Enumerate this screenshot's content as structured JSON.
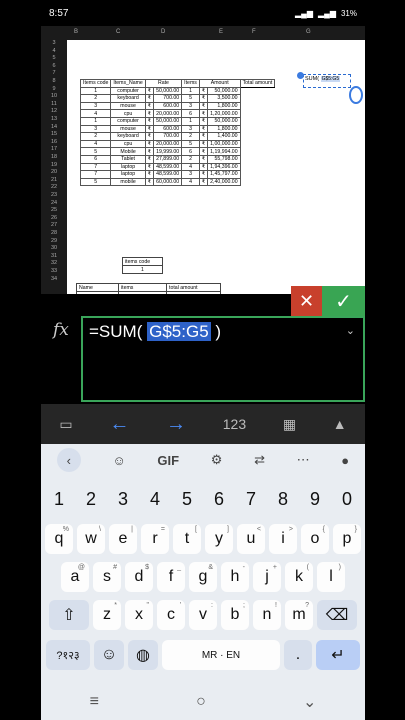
{
  "status": {
    "time": "8:57",
    "battery": "31%"
  },
  "sheet": {
    "columns": [
      "B",
      "C",
      "D",
      "E",
      "F",
      "G"
    ],
    "rows": [
      "3",
      "4",
      "5",
      "6",
      "7",
      "8",
      "9",
      "10",
      "11",
      "12",
      "13",
      "14",
      "15",
      "16",
      "17",
      "18",
      "19",
      "20",
      "21",
      "22",
      "23",
      "24",
      "25",
      "26",
      "27",
      "28",
      "29",
      "30",
      "31",
      "32",
      "33",
      "34"
    ],
    "headers": [
      "Items code",
      "Items_Name",
      "Rate",
      "Items",
      "Amount",
      "Total amount"
    ],
    "data": [
      [
        "1",
        "computer",
        "₹",
        "50,000.00",
        "1",
        "₹",
        "50,000.00"
      ],
      [
        "2",
        "keyboard",
        "₹",
        "700.00",
        "5",
        "₹",
        "3,500.00"
      ],
      [
        "3",
        "mouse",
        "₹",
        "600.00",
        "3",
        "₹",
        "1,800.00"
      ],
      [
        "4",
        "cpu",
        "₹",
        "20,000.00",
        "6",
        "₹",
        "1,20,000.00"
      ],
      [
        "1",
        "computer",
        "₹",
        "50,000.00",
        "1",
        "₹",
        "50,000.00"
      ],
      [
        "3",
        "mouse",
        "₹",
        "600.00",
        "3",
        "₹",
        "1,800.00"
      ],
      [
        "2",
        "keyboard",
        "₹",
        "700.00",
        "2",
        "₹",
        "1,400.00"
      ],
      [
        "4",
        "cpu",
        "₹",
        "20,000.00",
        "5",
        "₹",
        "1,00,000.00"
      ],
      [
        "5",
        "Mobile",
        "₹",
        "19,999.00",
        "6",
        "₹",
        "1,19,994.00"
      ],
      [
        "6",
        "Tablet",
        "₹",
        "27,899.00",
        "2",
        "₹",
        "55,798.00"
      ],
      [
        "7",
        "laptop",
        "₹",
        "48,599.00",
        "4",
        "₹",
        "1,94,396.00"
      ],
      [
        "7",
        "laptop",
        "₹",
        "48,599.00",
        "3",
        "₹",
        "1,45,797.00"
      ],
      [
        "5",
        "mobile",
        "₹",
        "60,000.00",
        "4",
        "₹",
        "2,40,000.00"
      ]
    ],
    "lookup": {
      "label": "items code",
      "value": "1"
    },
    "summary": {
      "name": "Name",
      "items": "items",
      "total": "total amount"
    },
    "tip": {
      "text": "SUM(",
      "ref": "G$5:G5"
    }
  },
  "formula": {
    "fx": "fx",
    "prefix": "=SUM(",
    "range": "G$5:G5",
    "suffix": ")"
  },
  "toolbar": {
    "numpad": "123"
  },
  "keyboard": {
    "suggestions": [
      "GIF"
    ],
    "numbers": [
      "1",
      "2",
      "3",
      "4",
      "5",
      "6",
      "7",
      "8",
      "9",
      "0"
    ],
    "row1": [
      "q",
      "w",
      "e",
      "r",
      "t",
      "y",
      "u",
      "i",
      "o",
      "p"
    ],
    "row1sup": [
      "%",
      "\\",
      "|",
      "=",
      "[",
      "]",
      "<",
      ">",
      "{",
      "}"
    ],
    "row2": [
      "a",
      "s",
      "d",
      "f",
      "g",
      "h",
      "j",
      "k",
      "l"
    ],
    "row2sup": [
      "@",
      "#",
      "$",
      "_",
      "&",
      "-",
      "+",
      "(",
      ")"
    ],
    "row3": [
      "z",
      "x",
      "c",
      "v",
      "b",
      "n",
      "m"
    ],
    "row3sup": [
      "*",
      "\"",
      "'",
      ":",
      ";",
      "!",
      "?"
    ],
    "symbols": "?१२३",
    "space": "MR · EN",
    "period": "."
  }
}
